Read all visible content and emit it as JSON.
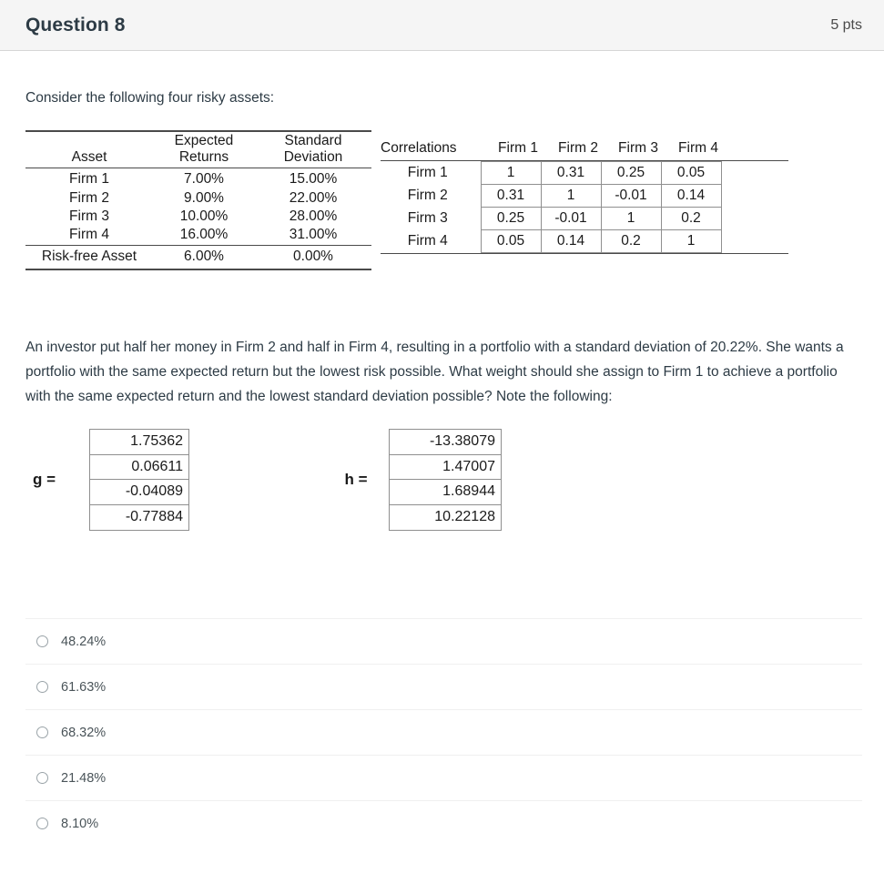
{
  "header": {
    "title": "Question 8",
    "points": "5 pts"
  },
  "intro": "Consider the following four risky assets:",
  "assets_table": {
    "headers": {
      "asset": "Asset",
      "expected_returns": "Expected\nReturns",
      "standard_deviation": "Standard\nDeviation"
    },
    "rows": [
      {
        "asset": "Firm 1",
        "expected_return": "7.00%",
        "standard_deviation": "15.00%"
      },
      {
        "asset": "Firm 2",
        "expected_return": "9.00%",
        "standard_deviation": "22.00%"
      },
      {
        "asset": "Firm 3",
        "expected_return": "10.00%",
        "standard_deviation": "28.00%"
      },
      {
        "asset": "Firm 4",
        "expected_return": "16.00%",
        "standard_deviation": "31.00%"
      }
    ],
    "footer_row": {
      "asset": "Risk-free Asset",
      "expected_return": "6.00%",
      "standard_deviation": "0.00%"
    }
  },
  "correlations_table": {
    "corner_label": "Correlations",
    "column_headers": [
      "Firm 1",
      "Firm 2",
      "Firm 3",
      "Firm 4"
    ],
    "row_labels": [
      "Firm 1",
      "Firm 2",
      "Firm 3",
      "Firm 4"
    ],
    "values": [
      [
        "1",
        "0.31",
        "0.25",
        "0.05"
      ],
      [
        "0.31",
        "1",
        "-0.01",
        "0.14"
      ],
      [
        "0.25",
        "-0.01",
        "1",
        "0.2"
      ],
      [
        "0.05",
        "0.14",
        "0.2",
        "1"
      ]
    ]
  },
  "question_text": "An investor put half her money in Firm 2 and half in Firm 4, resulting in a portfolio with a standard deviation of 20.22%.  She wants a portfolio with the same expected return but the lowest risk possible.  What weight should she assign to Firm 1 to achieve a portfolio with the same expected return  and the lowest standard deviation possible?  Note the following:",
  "vectors": {
    "g": {
      "label": "g =",
      "values": [
        "1.75362",
        "0.06611",
        "-0.04089",
        "-0.77884"
      ]
    },
    "h": {
      "label": "h =",
      "values": [
        "-13.38079",
        "1.47007",
        "1.68944",
        "10.22128"
      ]
    }
  },
  "answers": [
    {
      "label": "48.24%",
      "selected": false
    },
    {
      "label": "61.63%",
      "selected": false
    },
    {
      "label": "68.32%",
      "selected": false
    },
    {
      "label": "21.48%",
      "selected": false
    },
    {
      "label": "8.10%",
      "selected": false
    }
  ]
}
